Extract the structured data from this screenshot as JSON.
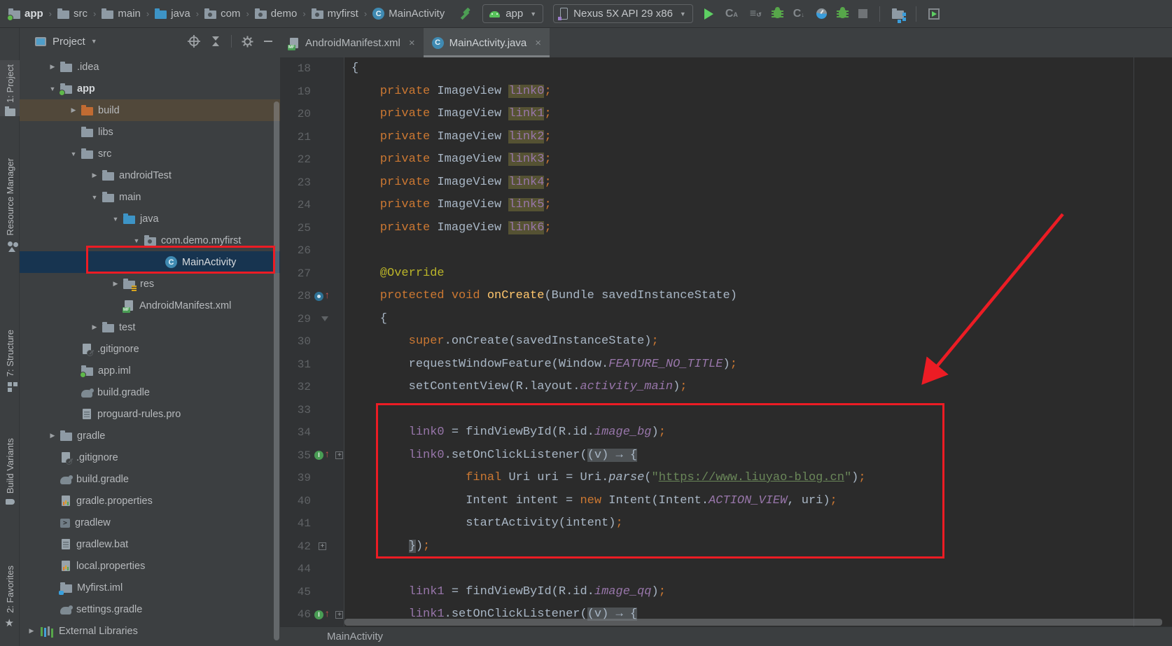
{
  "toolbar": {
    "separator": "›",
    "breadcrumbs": [
      {
        "label": "app",
        "icon": "folder-dot",
        "bold": true
      },
      {
        "label": "src",
        "icon": "folder"
      },
      {
        "label": "main",
        "icon": "folder"
      },
      {
        "label": "java",
        "icon": "folder-java"
      },
      {
        "label": "com",
        "icon": "package"
      },
      {
        "label": "demo",
        "icon": "package"
      },
      {
        "label": "myfirst",
        "icon": "package"
      },
      {
        "label": "MainActivity",
        "icon": "class"
      }
    ],
    "run_config": "app",
    "device": "Nexus 5X API 29 x86"
  },
  "sidebar": {
    "items": [
      {
        "label": "1: Project",
        "icon": "project",
        "active": true
      },
      {
        "label": "Resource Manager",
        "icon": "resource",
        "active": false
      },
      {
        "label": "7: Structure",
        "icon": "structure",
        "active": false
      },
      {
        "label": "Build Variants",
        "icon": "variants",
        "active": false
      },
      {
        "label": "2: Favorites",
        "icon": "favorites",
        "active": false
      }
    ]
  },
  "project": {
    "title": "Project",
    "tree": [
      {
        "label": ".idea",
        "depth": 1,
        "icon": "folder",
        "arrow": "right",
        "state": "normal"
      },
      {
        "label": "app",
        "depth": 1,
        "icon": "folder-dot",
        "arrow": "down",
        "state": "normal",
        "bold": true
      },
      {
        "label": "build",
        "depth": 2,
        "icon": "folder-build",
        "arrow": "right",
        "state": "highlighted"
      },
      {
        "label": "libs",
        "depth": 2,
        "icon": "folder",
        "arrow": "none",
        "state": "normal"
      },
      {
        "label": "src",
        "depth": 2,
        "icon": "folder",
        "arrow": "down",
        "state": "normal"
      },
      {
        "label": "androidTest",
        "depth": 3,
        "icon": "folder",
        "arrow": "right",
        "state": "normal"
      },
      {
        "label": "main",
        "depth": 3,
        "icon": "folder",
        "arrow": "down",
        "state": "normal"
      },
      {
        "label": "java",
        "depth": 4,
        "icon": "folder-java",
        "arrow": "down",
        "state": "normal"
      },
      {
        "label": "com.demo.myfirst",
        "depth": 5,
        "icon": "package",
        "arrow": "down",
        "state": "normal"
      },
      {
        "label": "MainActivity",
        "depth": 6,
        "icon": "class",
        "arrow": "none",
        "state": "selected"
      },
      {
        "label": "res",
        "depth": 4,
        "icon": "folder-res",
        "arrow": "right",
        "state": "normal"
      },
      {
        "label": "AndroidManifest.xml",
        "depth": 4,
        "icon": "manifest",
        "arrow": "none",
        "state": "normal"
      },
      {
        "label": "test",
        "depth": 3,
        "icon": "folder",
        "arrow": "right",
        "state": "normal"
      },
      {
        "label": ".gitignore",
        "depth": 2,
        "icon": "gitignore",
        "arrow": "none",
        "state": "normal"
      },
      {
        "label": "app.iml",
        "depth": 2,
        "icon": "folder-dot",
        "arrow": "none",
        "state": "normal"
      },
      {
        "label": "build.gradle",
        "depth": 2,
        "icon": "gradle",
        "arrow": "none",
        "state": "normal"
      },
      {
        "label": "proguard-rules.pro",
        "depth": 2,
        "icon": "file",
        "arrow": "none",
        "state": "normal"
      },
      {
        "label": "gradle",
        "depth": 1,
        "icon": "folder",
        "arrow": "right",
        "state": "normal"
      },
      {
        "label": ".gitignore",
        "depth": 1,
        "icon": "gitignore",
        "arrow": "none",
        "state": "normal"
      },
      {
        "label": "build.gradle",
        "depth": 1,
        "icon": "gradle",
        "arrow": "none",
        "state": "normal"
      },
      {
        "label": "gradle.properties",
        "depth": 1,
        "icon": "properties",
        "arrow": "none",
        "state": "normal"
      },
      {
        "label": "gradlew",
        "depth": 1,
        "icon": "terminal",
        "arrow": "none",
        "state": "normal"
      },
      {
        "label": "gradlew.bat",
        "depth": 1,
        "icon": "file",
        "arrow": "none",
        "state": "normal"
      },
      {
        "label": "local.properties",
        "depth": 1,
        "icon": "properties",
        "arrow": "none",
        "state": "normal"
      },
      {
        "label": "Myfirst.iml",
        "depth": 1,
        "icon": "module",
        "arrow": "none",
        "state": "normal"
      },
      {
        "label": "settings.gradle",
        "depth": 1,
        "icon": "gradle",
        "arrow": "none",
        "state": "normal"
      },
      {
        "label": "External Libraries",
        "depth": 0,
        "icon": "extlib",
        "arrow": "right",
        "state": "normal"
      }
    ]
  },
  "editor": {
    "tabs": [
      {
        "label": "AndroidManifest.xml",
        "icon": "manifest",
        "active": false,
        "close": "×"
      },
      {
        "label": "MainActivity.java",
        "icon": "class",
        "active": true,
        "close": "×"
      }
    ],
    "bottom_breadcrumb": "MainActivity",
    "lines": [
      {
        "n": "18",
        "i": [],
        "s": [
          [
            "{",
            "d"
          ]
        ]
      },
      {
        "n": "19",
        "i": [],
        "s": [
          [
            "    private",
            "k"
          ],
          [
            " ImageView ",
            "d"
          ],
          [
            "link0",
            "hl"
          ],
          [
            ";",
            "k"
          ]
        ]
      },
      {
        "n": "20",
        "i": [],
        "s": [
          [
            "    private",
            "k"
          ],
          [
            " ImageView ",
            "d"
          ],
          [
            "link1",
            "hl"
          ],
          [
            ";",
            "k"
          ]
        ]
      },
      {
        "n": "21",
        "i": [],
        "s": [
          [
            "    private",
            "k"
          ],
          [
            " ImageView ",
            "d"
          ],
          [
            "link2",
            "hl"
          ],
          [
            ";",
            "k"
          ]
        ]
      },
      {
        "n": "22",
        "i": [],
        "s": [
          [
            "    private",
            "k"
          ],
          [
            " ImageView ",
            "d"
          ],
          [
            "link3",
            "hl"
          ],
          [
            ";",
            "k"
          ]
        ]
      },
      {
        "n": "23",
        "i": [],
        "s": [
          [
            "    private",
            "k"
          ],
          [
            " ImageView ",
            "d"
          ],
          [
            "link4",
            "hl"
          ],
          [
            ";",
            "k"
          ]
        ]
      },
      {
        "n": "24",
        "i": [],
        "s": [
          [
            "    private",
            "k"
          ],
          [
            " ImageView ",
            "d"
          ],
          [
            "link5",
            "hl"
          ],
          [
            ";",
            "k"
          ]
        ]
      },
      {
        "n": "25",
        "i": [],
        "s": [
          [
            "    private",
            "k"
          ],
          [
            " ImageView ",
            "d"
          ],
          [
            "link6",
            "hl"
          ],
          [
            ";",
            "k"
          ]
        ]
      },
      {
        "n": "26",
        "i": [],
        "s": []
      },
      {
        "n": "27",
        "i": [],
        "s": [
          [
            "    @Override",
            "a"
          ]
        ]
      },
      {
        "n": "28",
        "i": [
          "ov"
        ],
        "s": [
          [
            "    protected void",
            "k"
          ],
          [
            " ",
            "d"
          ],
          [
            "onCreate",
            "m"
          ],
          [
            "(Bundle savedInstanceState)",
            "d"
          ]
        ]
      },
      {
        "n": "29",
        "i": [
          "fv"
        ],
        "s": [
          [
            "    {",
            "d"
          ]
        ]
      },
      {
        "n": "30",
        "i": [],
        "s": [
          [
            "        super",
            "k"
          ],
          [
            ".onCreate(savedInstanceState)",
            "d"
          ],
          [
            ";",
            "k"
          ]
        ]
      },
      {
        "n": "31",
        "i": [],
        "s": [
          [
            "        requestWindowFeature(Window.",
            "d"
          ],
          [
            "FEATURE_NO_TITLE",
            "fi"
          ],
          [
            ")",
            "d"
          ],
          [
            ";",
            "k"
          ]
        ]
      },
      {
        "n": "32",
        "i": [],
        "s": [
          [
            "        setContentView(R.layout.",
            "d"
          ],
          [
            "activity_main",
            "fi"
          ],
          [
            ")",
            "d"
          ],
          [
            ";",
            "k"
          ]
        ]
      },
      {
        "n": "33",
        "i": [],
        "s": []
      },
      {
        "n": "34",
        "i": [],
        "s": [
          [
            "        ",
            "d"
          ],
          [
            "link0",
            "f"
          ],
          [
            " = findViewById(R.id.",
            "d"
          ],
          [
            "image_bg",
            "fi"
          ],
          [
            ")",
            "d"
          ],
          [
            ";",
            "k"
          ]
        ]
      },
      {
        "n": "35",
        "i": [
          "im",
          "pl"
        ],
        "s": [
          [
            "        ",
            "d"
          ],
          [
            "link0",
            "f"
          ],
          [
            ".setOnClickListener(",
            "d"
          ],
          [
            "(v) → {",
            "fd"
          ]
        ]
      },
      {
        "n": "39",
        "i": [],
        "s": [
          [
            "                final",
            "k"
          ],
          [
            " Uri uri = Uri.",
            "d"
          ],
          [
            "parse",
            "it"
          ],
          [
            "(",
            "d"
          ],
          [
            "\"",
            "s"
          ],
          [
            "https://www.liuyao-blog.cn",
            "su"
          ],
          [
            "\"",
            "s"
          ],
          [
            ")",
            "d"
          ],
          [
            ";",
            "k"
          ]
        ]
      },
      {
        "n": "40",
        "i": [],
        "s": [
          [
            "                Intent intent = ",
            "d"
          ],
          [
            "new",
            "k"
          ],
          [
            " Intent(Intent.",
            "d"
          ],
          [
            "ACTION_VIEW",
            "fi"
          ],
          [
            ", uri)",
            "d"
          ],
          [
            ";",
            "k"
          ]
        ]
      },
      {
        "n": "41",
        "i": [],
        "s": [
          [
            "                startActivity(intent)",
            "d"
          ],
          [
            ";",
            "k"
          ]
        ]
      },
      {
        "n": "42",
        "i": [
          "pl"
        ],
        "s": [
          [
            "        ",
            "d"
          ],
          [
            "}",
            "fd"
          ],
          [
            ")",
            "d"
          ],
          [
            ";",
            "k"
          ]
        ]
      },
      {
        "n": "44",
        "i": [],
        "s": []
      },
      {
        "n": "45",
        "i": [],
        "s": [
          [
            "        ",
            "d"
          ],
          [
            "link1",
            "f"
          ],
          [
            " = findViewById(R.id.",
            "d"
          ],
          [
            "image_qq",
            "fi"
          ],
          [
            ")",
            "d"
          ],
          [
            ";",
            "k"
          ]
        ]
      },
      {
        "n": "46",
        "i": [
          "im",
          "pl"
        ],
        "s": [
          [
            "        ",
            "d"
          ],
          [
            "link1",
            "f"
          ],
          [
            ".setOnClickListener(",
            "d"
          ],
          [
            "(v) → {",
            "fd"
          ]
        ]
      }
    ]
  },
  "colors": {
    "annotation_red": "#ec1c24",
    "selection_blue": "#173450",
    "drag_highlight_brown": "#51483a",
    "identifier_highlight_olive": "#555233",
    "keyword_orange": "#cc7832",
    "field_purple": "#9876aa",
    "string_green": "#6a8759",
    "annotation_yellow": "#bbb529",
    "method_yellow": "#ffc66d",
    "panel_bg": "#3c3f41",
    "editor_bg": "#2b2b2b"
  }
}
